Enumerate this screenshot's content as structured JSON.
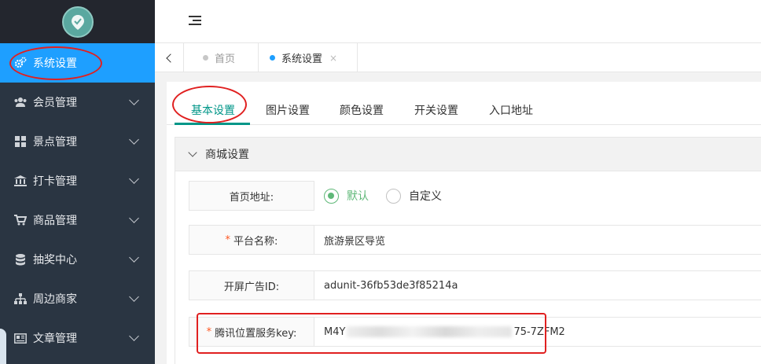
{
  "sidebar": {
    "items": [
      {
        "label": "系统设置",
        "icon": "gears-icon"
      },
      {
        "label": "会员管理",
        "icon": "users-icon"
      },
      {
        "label": "景点管理",
        "icon": "grid-icon"
      },
      {
        "label": "打卡管理",
        "icon": "bank-icon"
      },
      {
        "label": "商品管理",
        "icon": "cart-icon"
      },
      {
        "label": "抽奖中心",
        "icon": "database-icon"
      },
      {
        "label": "周边商家",
        "icon": "sitemap-icon"
      },
      {
        "label": "文章管理",
        "icon": "article-icon"
      }
    ]
  },
  "tabs": {
    "home": "首页",
    "current": "系统设置",
    "close": "×"
  },
  "subtabs": [
    "基本设置",
    "图片设置",
    "颜色设置",
    "开关设置",
    "入口地址"
  ],
  "section": {
    "title": "商城设置"
  },
  "form": {
    "homepage_label": "首页地址:",
    "homepage_options": [
      "默认",
      "自定义"
    ],
    "platform_label": "平台名称:",
    "platform_value": "旅游景区导览",
    "ad_label": "开屏广告ID:",
    "ad_value": "adunit-36fb53de3f85214a",
    "map_key_label": "腾讯位置服务key:",
    "map_key_prefix": "M4Y",
    "map_key_suffix": "75-7ZFM2",
    "required_mark": "*"
  },
  "colors": {
    "sidebar_bg": "#2a3542",
    "active_blue": "#1e9fff",
    "accent_green": "#009688",
    "radio_green": "#5fb878",
    "annotation_red": "#e02020"
  }
}
